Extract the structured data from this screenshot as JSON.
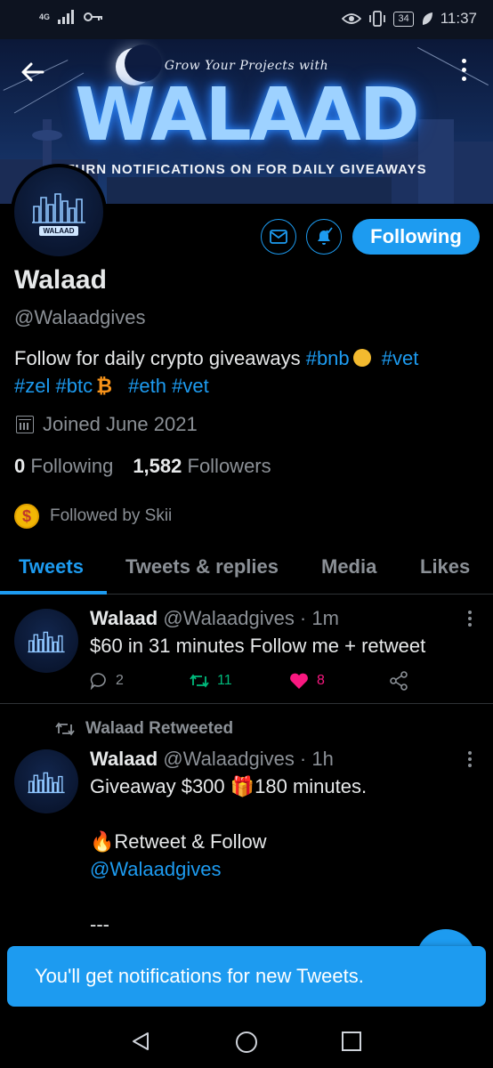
{
  "status_bar": {
    "network": "4G",
    "battery": "34",
    "time": "11:37"
  },
  "banner": {
    "tagline": "Grow Your Projects with",
    "logo_text": "WALAAD",
    "subtitle": "TURN NOTIFICATIONS ON FOR DAILY GIVEAWAYS"
  },
  "header": {
    "back_icon": "arrow-left-icon",
    "more_icon": "more-vertical-icon"
  },
  "profile": {
    "avatar_label": "WALAAD",
    "name": "Walaad",
    "handle": "@Walaadgives",
    "bio": {
      "text": "Follow for daily crypto giveaways",
      "tags": [
        "#bnb",
        "#vet",
        "#zel",
        "#btc",
        "#eth",
        "#vet"
      ]
    },
    "joined": "Joined June 2021",
    "following_count": "0",
    "following_label": "Following",
    "followers_count": "1,582",
    "followers_label": "Followers",
    "followed_by": "Followed by Skii",
    "follow_button": "Following"
  },
  "tabs": [
    {
      "label": "Tweets",
      "active": true
    },
    {
      "label": "Tweets & replies",
      "active": false
    },
    {
      "label": "Media",
      "active": false
    },
    {
      "label": "Likes",
      "active": false
    }
  ],
  "tweets": [
    {
      "name": "Walaad",
      "meta": "@Walaadgives · 1m",
      "text": "$60 in 31 minutes Follow me + retweet",
      "replies": "2",
      "retweets": "11",
      "likes": "8"
    },
    {
      "retweeted_by": "Walaad Retweeted",
      "name": "Walaad",
      "meta": "@Walaadgives · 1h",
      "line1": "Giveaway $300 🎁180 minutes.",
      "line2": "🔥Retweet & Follow",
      "line3": "@Walaadgives",
      "line4": "---"
    }
  ],
  "toast": "You'll get notifications for new Tweets.",
  "colors": {
    "accent": "#1d9bf0",
    "retweet": "#00ba7c",
    "like": "#f91880",
    "background": "#000000"
  }
}
